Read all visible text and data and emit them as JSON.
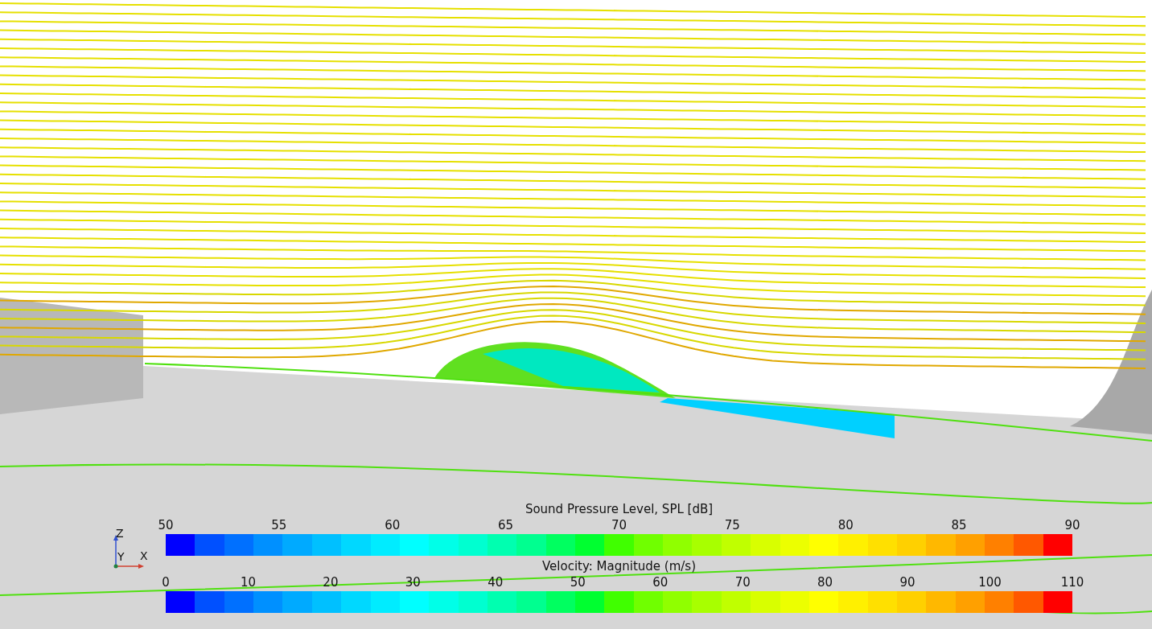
{
  "triad": {
    "z": "Z",
    "y": "Y",
    "x": "X"
  },
  "legends": [
    {
      "title": "Sound Pressure Level, SPL [dB]",
      "ticks": [
        "50",
        "55",
        "60",
        "65",
        "70",
        "75",
        "80",
        "85",
        "90"
      ]
    },
    {
      "title": "Velocity: Magnitude (m/s)",
      "ticks": [
        "0",
        "10",
        "20",
        "30",
        "40",
        "50",
        "60",
        "70",
        "80",
        "90",
        "100",
        "110"
      ]
    }
  ]
}
